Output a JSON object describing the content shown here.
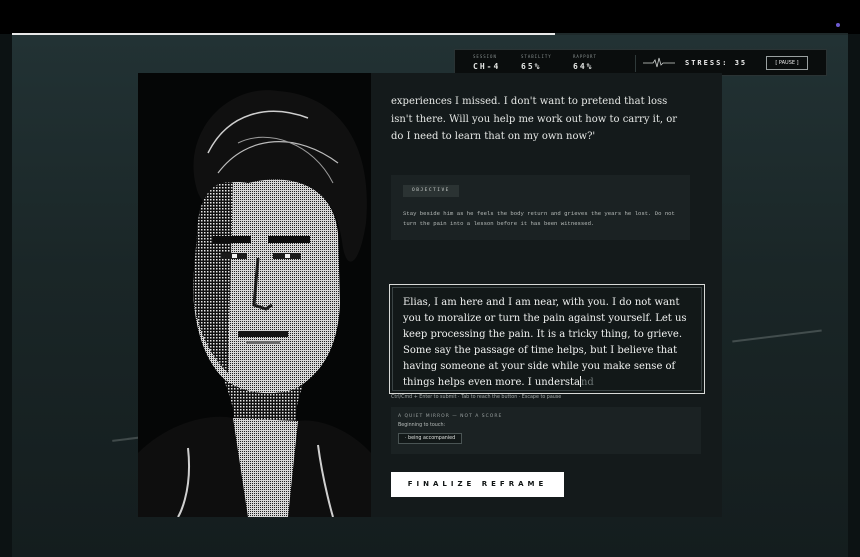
{
  "progress": {
    "fraction": 0.65
  },
  "hud": {
    "session_label": "SESSION",
    "session_value": "CH-4",
    "stability_label": "STABILITY",
    "stability_value": "65%",
    "rapport_label": "RAPPORT",
    "rapport_value": "64%",
    "stress": "STRESS: 35",
    "pause": "[ PAUSE ]"
  },
  "story": {
    "text": "experiences I missed. I don't want to pretend that loss isn't there. Will you help me work out how to carry it, or do I need to learn that on my own now?'"
  },
  "objective": {
    "tag": "OBJECTIVE",
    "text": "Stay beside him as he feels the body return and grieves the years he lost. Do not turn the pain into a lesson before it has been witnessed."
  },
  "reply": {
    "typed": "Elias, I am here and I am near, with you. I do not want you to moralize or turn the pain against yourself. Let us keep processing the pain. It is a tricky thing, to grieve. Some say the passage of time helps, but I believe that having someone at your side while you make sense of things helps even more. I understa",
    "ghost": "nd"
  },
  "hint": "Ctrl/Cmd + Enter to submit · Tab to reach the button · Escape to pause",
  "mirror": {
    "title": "A QUIET MIRROR — NOT A SCORE",
    "subtitle": "Beginning to touch:",
    "chip": "· being accompanied"
  },
  "finalize_label": "FINALIZE REFRAME",
  "colors": {
    "accent_dot": "#6d5bd0",
    "background": "#0c1213",
    "button": "#ffffff"
  }
}
